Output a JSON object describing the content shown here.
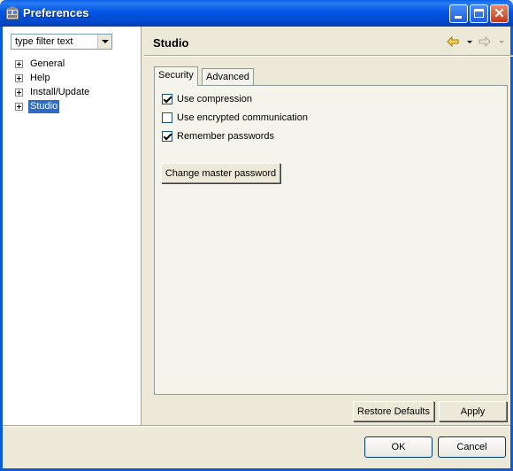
{
  "window": {
    "title": "Preferences"
  },
  "filter": {
    "placeholder": "type filter text"
  },
  "tree": {
    "items": [
      {
        "label": "General"
      },
      {
        "label": "Help"
      },
      {
        "label": "Install/Update"
      },
      {
        "label": "Studio"
      }
    ]
  },
  "page": {
    "title": "Studio"
  },
  "tabs": [
    {
      "label": "Security"
    },
    {
      "label": "Advanced"
    }
  ],
  "security": {
    "options": [
      {
        "label": "Use compression",
        "checked": true
      },
      {
        "label": "Use encrypted communication",
        "checked": false
      },
      {
        "label": "Remember passwords",
        "checked": true
      }
    ],
    "change_master_password_label": "Change master password"
  },
  "page_buttons": {
    "restore_defaults": "Restore Defaults",
    "apply": "Apply"
  },
  "dialog_buttons": {
    "ok": "OK",
    "cancel": "Cancel"
  },
  "icons": {
    "app": "preferences-app-icon",
    "back": "back-arrow-icon",
    "forward": "forward-arrow-icon"
  },
  "colors": {
    "title_bar": "#0055e5",
    "selection": "#316ac5",
    "dialog_bg": "#ece9d8"
  }
}
